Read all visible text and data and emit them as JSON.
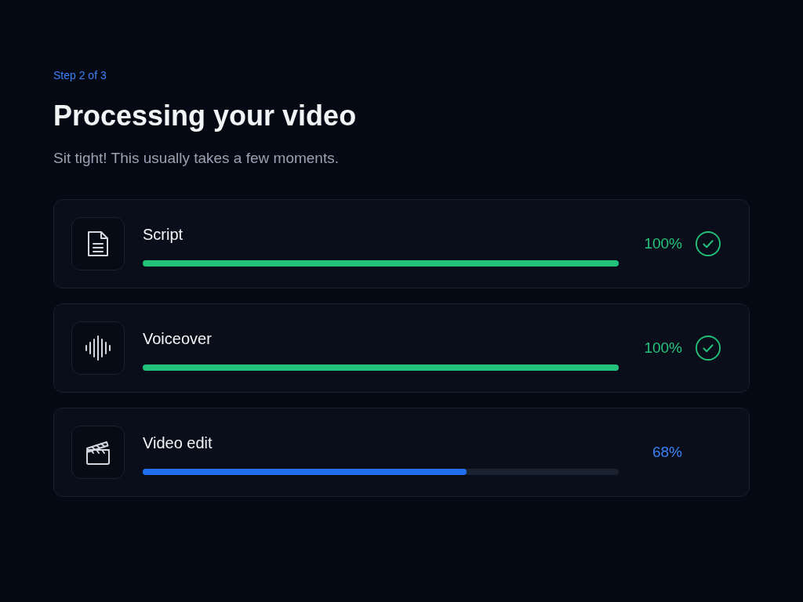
{
  "step_label": "Step 2 of 3",
  "title": "Processing your video",
  "subtitle": "Sit tight! This usually takes a few moments.",
  "tasks": [
    {
      "kind": "document",
      "name": "Script",
      "level": 1.0,
      "percent": "100%",
      "complete": true
    },
    {
      "kind": "waveform",
      "name": "Voiceover",
      "level": 1.0,
      "percent": "100%",
      "complete": true
    },
    {
      "kind": "clapperboard",
      "name": "Video edit",
      "level": 0.68,
      "percent": "68%",
      "complete": false
    }
  ]
}
